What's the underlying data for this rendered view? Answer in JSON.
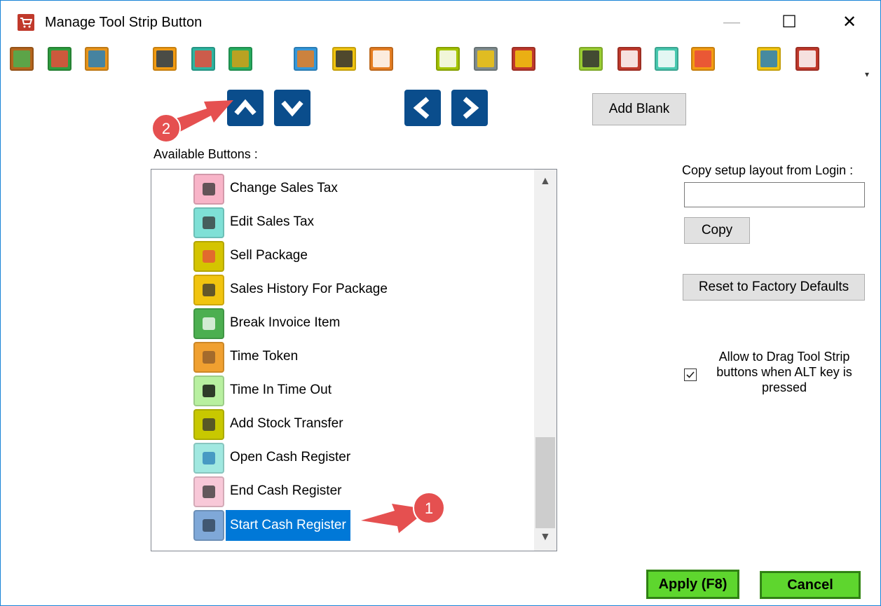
{
  "window": {
    "title": "Manage Tool Strip Button",
    "minimize": "—",
    "maximize": "☐",
    "close": "✕"
  },
  "toolstrip": {
    "buttons": [
      {
        "icon": "cash-register-icon",
        "color": "#b5651d",
        "inner": "#4caf50"
      },
      {
        "icon": "open-register-icon",
        "color": "#2e9e3f",
        "inner": "#e74c3c"
      },
      {
        "icon": "close-register-icon",
        "color": "#e8941a",
        "inner": "#2980b9"
      },
      {
        "icon": "edit-invoice-icon",
        "color": "#f39c12",
        "inner": "#2c3e50"
      },
      {
        "icon": "cart-icon",
        "color": "#2eb5a0",
        "inner": "#e74c3c"
      },
      {
        "icon": "stock-download-icon",
        "color": "#27ae60",
        "inner": "#d4a017"
      },
      {
        "icon": "transfer-icon",
        "color": "#3498db",
        "inner": "#e67e22"
      },
      {
        "icon": "notepad-icon",
        "color": "#f1c40f",
        "inner": "#333333"
      },
      {
        "icon": "return-icon",
        "color": "#e67e22",
        "inner": "#ffffff"
      },
      {
        "icon": "checklist-icon",
        "color": "#a4c400",
        "inner": "#ffffff"
      },
      {
        "icon": "spot-icon",
        "color": "#7f8c8d",
        "inner": "#f1c40f"
      },
      {
        "icon": "cancel-icon",
        "color": "#c0392b",
        "inner": "#f1c40f"
      },
      {
        "icon": "calculator-icon",
        "color": "#9acd32",
        "inner": "#333333"
      },
      {
        "icon": "tax-calculator-icon",
        "color": "#c0392b",
        "inner": "#ffffff"
      },
      {
        "icon": "rs-calculator-icon",
        "color": "#48c9b0",
        "inner": "#ffffff"
      },
      {
        "icon": "tiles-icon",
        "color": "#f39c12",
        "inner": "#e74c3c"
      },
      {
        "icon": "user-icon",
        "color": "#f1c40f",
        "inner": "#2980b9"
      },
      {
        "icon": "counter-icon",
        "color": "#c0392b",
        "inner": "#ffffff"
      }
    ],
    "overflow": "▾"
  },
  "buttons": {
    "add_blank": "Add Blank",
    "copy": "Copy",
    "reset": "Reset to Factory Defaults",
    "apply": "Apply (F8)",
    "cancel": "Cancel"
  },
  "labels": {
    "available": "Available  Buttons :",
    "copy_from": "Copy setup layout from Login :",
    "drag": "Allow to Drag Tool Strip buttons when ALT key is pressed"
  },
  "copy_input_value": "",
  "drag_checked": true,
  "available_buttons": [
    {
      "label": "Change Sales Tax",
      "icon": "change-sales-tax-icon",
      "bg": "#f8b4c8",
      "fg": "#333333"
    },
    {
      "label": "Edit Sales Tax",
      "icon": "edit-sales-tax-icon",
      "bg": "#7fe0d6",
      "fg": "#333333"
    },
    {
      "label": "Sell Package",
      "icon": "sell-package-icon",
      "bg": "#d4c400",
      "fg": "#e74c3c"
    },
    {
      "label": "Sales History For Package",
      "icon": "package-history-icon",
      "bg": "#f1c40f",
      "fg": "#333333"
    },
    {
      "label": "Break Invoice Item",
      "icon": "break-invoice-icon",
      "bg": "#4caf50",
      "fg": "#ffffff"
    },
    {
      "label": "Time Token",
      "icon": "time-token-icon",
      "bg": "#f0a030",
      "fg": "#8b5a2b"
    },
    {
      "label": "Time In Time Out",
      "icon": "clock-icon",
      "bg": "#b8f0a0",
      "fg": "#000000"
    },
    {
      "label": "Add Stock Transfer",
      "icon": "stock-transfer-icon",
      "bg": "#c8c800",
      "fg": "#333333"
    },
    {
      "label": "Open Cash Register",
      "icon": "open-cash-register-icon",
      "bg": "#a0e8e0",
      "fg": "#2980b9"
    },
    {
      "label": "End Cash Register",
      "icon": "end-cash-register-icon",
      "bg": "#f8c8d8",
      "fg": "#333333"
    },
    {
      "label": "Start Cash Register",
      "icon": "start-cash-register-icon",
      "bg": "#7fa8d8",
      "fg": "#2c3e50"
    }
  ],
  "selected_index": 10,
  "callouts": [
    {
      "number": "1"
    },
    {
      "number": "2"
    }
  ],
  "scroll": {
    "up": "▲",
    "down": "▼"
  }
}
